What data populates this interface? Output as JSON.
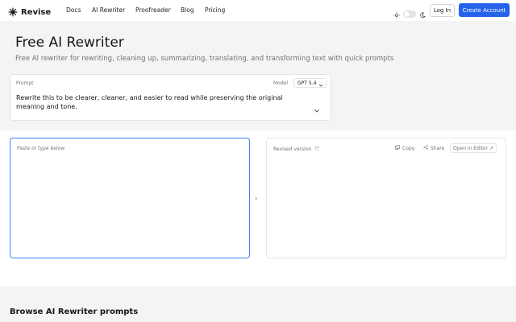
{
  "brand": {
    "name": "Revise"
  },
  "nav": {
    "links": [
      "Docs",
      "AI Rewriter",
      "Proofreader",
      "Blog",
      "Pricing"
    ],
    "login_label": "Log In",
    "create_account_label": "Create Account"
  },
  "hero": {
    "title": "Free AI Rewriter",
    "subtitle": "Free AI rewriter for rewriting, cleaning up, summarizing, translating, and transforming text with quick prompts"
  },
  "prompt": {
    "label": "Prompt",
    "model_label": "Model",
    "model_value": "GPT 5.4",
    "text": "Rewrite this to be clearer, cleaner, and easier to read while preserving the original meaning and tone."
  },
  "editor": {
    "input_placeholder": "Paste or type below",
    "output_label": "Revised version",
    "copy_label": "Copy",
    "share_label": "Share",
    "open_editor_label": "Open in Editor ↗",
    "swap_icon": "›"
  },
  "browse": {
    "heading": "Browse AI Rewriter prompts"
  },
  "colors": {
    "accent": "#2563eb",
    "focus_border": "#3b82f6",
    "muted_text": "#71717a"
  },
  "icons": [
    "logo-icon",
    "sun-icon",
    "moon-icon",
    "chevron-down-icon",
    "refresh-icon",
    "copy-icon",
    "share-icon",
    "chevron-right-icon"
  ]
}
